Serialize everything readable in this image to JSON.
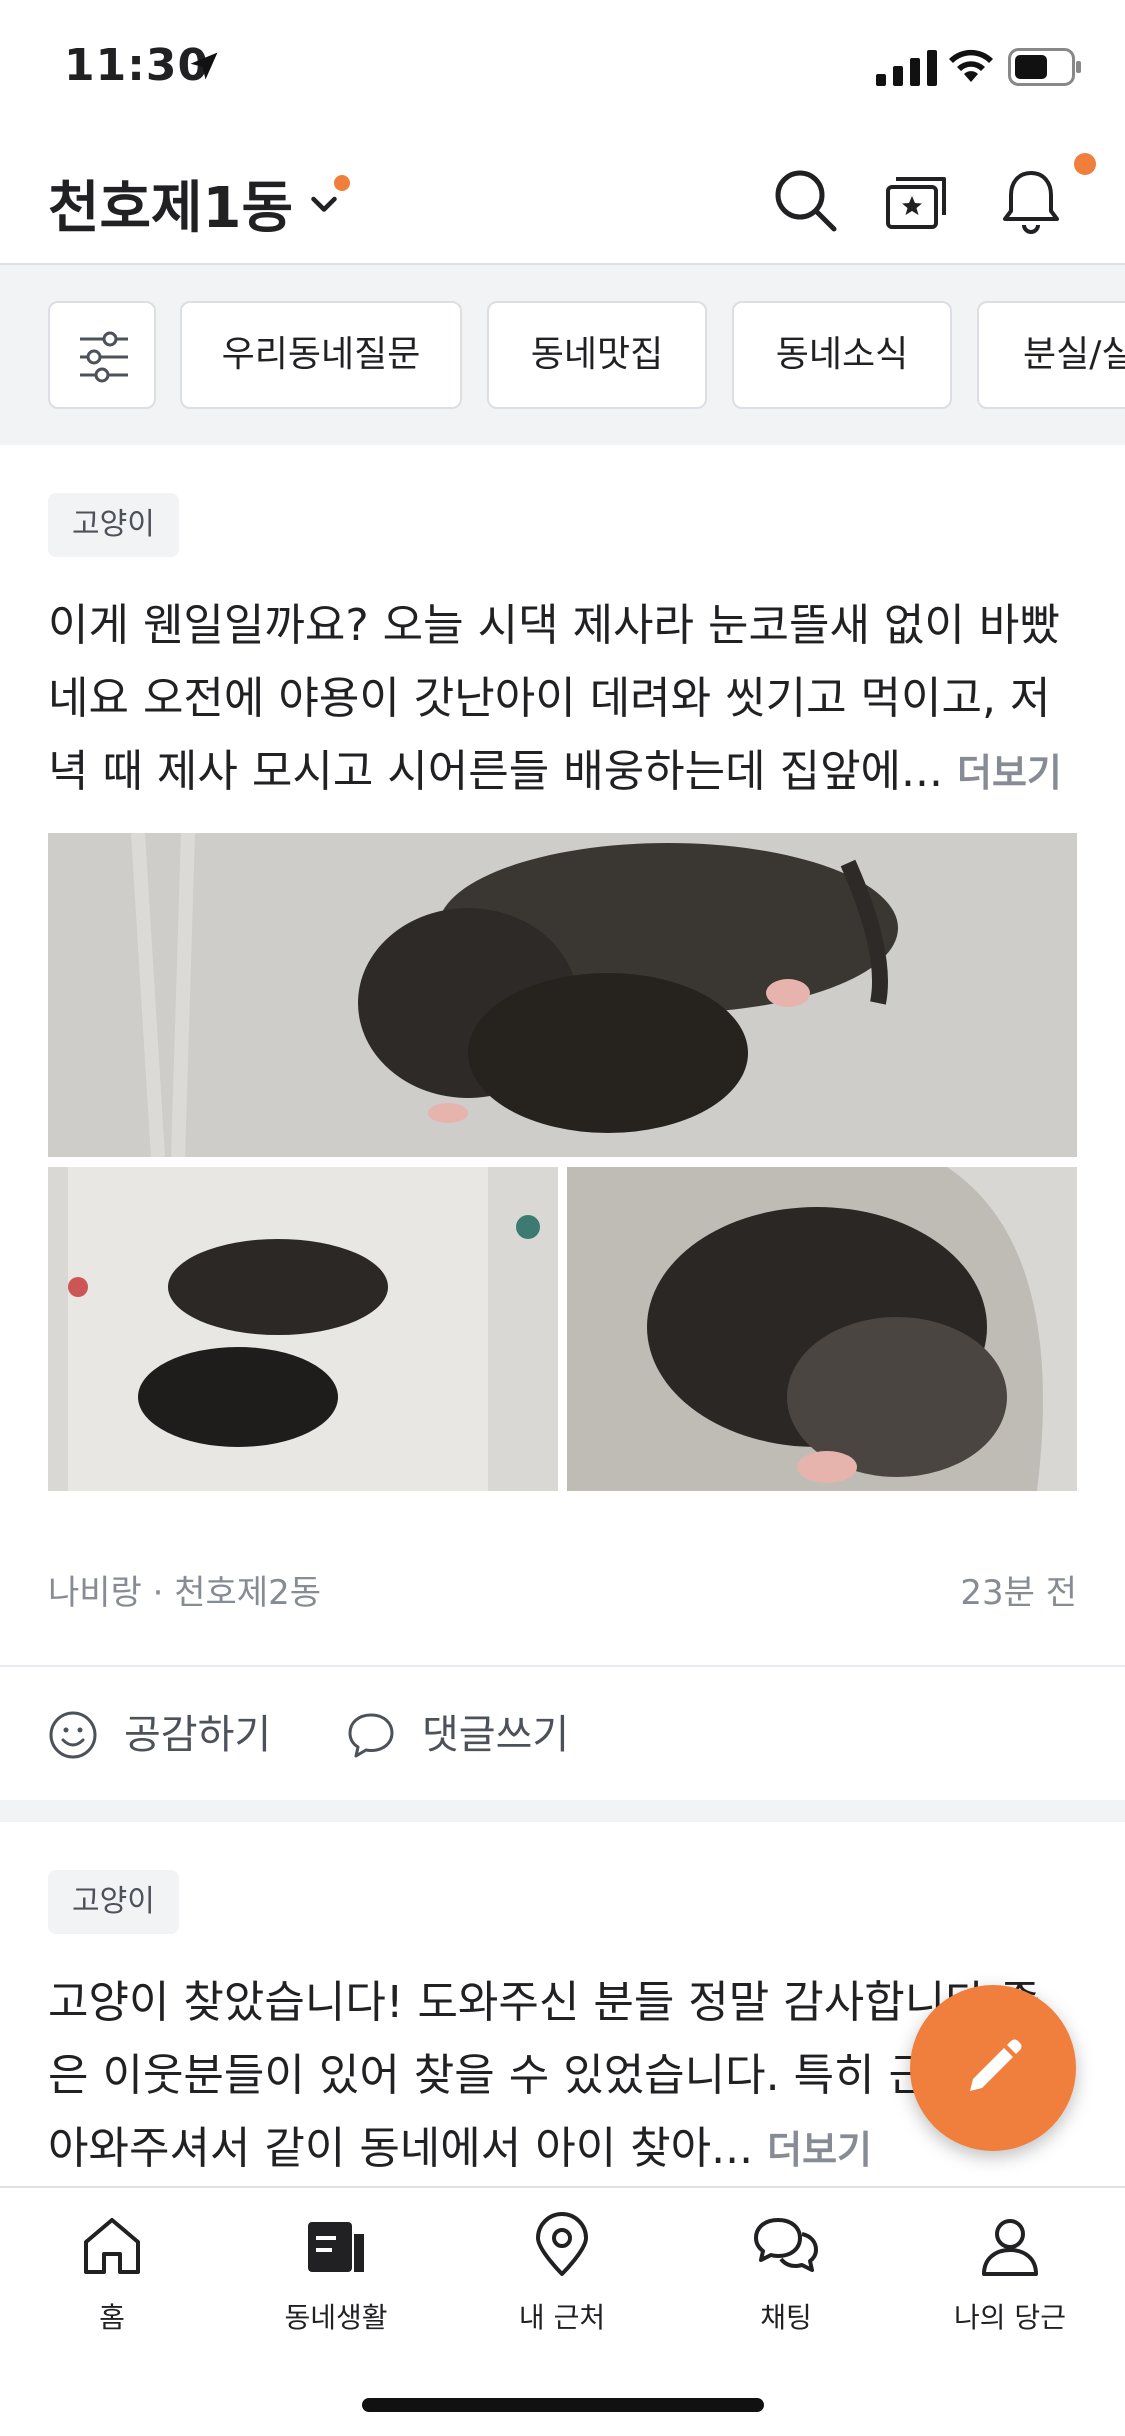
{
  "status_bar": {
    "time": "11:30"
  },
  "header": {
    "location": "천호제1동"
  },
  "categories": [
    "우리동네질문",
    "동네맛집",
    "동네소식",
    "분실/실"
  ],
  "posts": [
    {
      "tag": "고양이",
      "body": "이게 웬일일까요? 오늘 시댁 제사라 눈코뜰새 없이 바빴네요 오전에 야용이 갓난아이 데려와 씻기고 먹이고, 저녁 때 제사 모시고 시어른들 배웅하는데 집앞에...",
      "more": "더보기",
      "author": "나비랑",
      "neighborhood": "천호제2동",
      "time_ago": "23분 전",
      "like_label": "공감하기",
      "comment_label": "댓글쓰기"
    },
    {
      "tag": "고양이",
      "body": "고양이 찾았습니다!  도와주신 분들 정말 감사합니다 좋은 이웃분들이 있어 찾을 수 있었습니다.  특히 근보고 찾아와주셔서 같이 동네에서 아이 찾아...",
      "more": "더보기"
    }
  ],
  "tabs": [
    {
      "label": "홈",
      "icon": "home-icon"
    },
    {
      "label": "동네생활",
      "icon": "community-icon"
    },
    {
      "label": "내 근처",
      "icon": "location-pin-icon"
    },
    {
      "label": "채팅",
      "icon": "chat-icon"
    },
    {
      "label": "나의 당근",
      "icon": "person-icon"
    }
  ],
  "colors": {
    "accent": "#f07e3c",
    "text": "#212124",
    "muted": "#868b94"
  }
}
